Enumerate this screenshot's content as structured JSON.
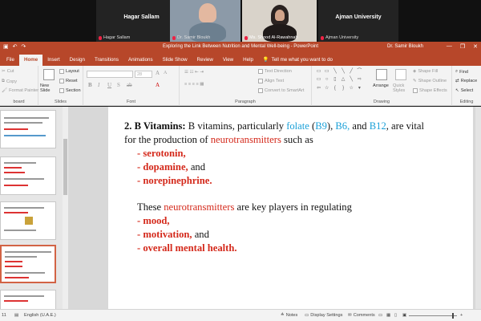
{
  "video": {
    "tiles": [
      {
        "name": "Hagar Sallam",
        "label": "Hagar Sallam"
      },
      {
        "name": "",
        "label": "Dr. Samir Bloukh"
      },
      {
        "name": "",
        "label": "Ms. Shood Al-Rawahnah"
      },
      {
        "name": "Ajman University",
        "label": "Ajman University"
      }
    ]
  },
  "titlebar": {
    "title": "Exploring the Link Between Nutrition and Mental Well-being  -  PowerPoint",
    "user": "Dr. Samir Bloukh",
    "minimize": "—",
    "restore": "❐",
    "close": "✕"
  },
  "tabs": [
    "File",
    "Home",
    "Insert",
    "Design",
    "Transitions",
    "Animations",
    "Slide Show",
    "Review",
    "View",
    "Help"
  ],
  "tell_me": "Tell me what you want to do",
  "ribbon": {
    "clipboard": {
      "cut": "Cut",
      "copy": "Copy",
      "format_painter": "Format Painter",
      "label": "board"
    },
    "slides": {
      "new_slide": "New Slide",
      "layout": "Layout",
      "reset": "Reset",
      "section": "Section",
      "label": "Slides"
    },
    "font": {
      "size": "28",
      "label": "Font"
    },
    "paragraph": {
      "text_direction": "Text Direction",
      "align_text": "Align Text",
      "convert": "Convert to SmartArt",
      "label": "Paragraph"
    },
    "drawing": {
      "arrange": "Arrange",
      "quick_styles": "Quick Styles",
      "shape_fill": "Shape Fill",
      "shape_outline": "Shape Outline",
      "shape_effects": "Shape Effects",
      "label": "Drawing"
    },
    "editing": {
      "find": "Find",
      "replace": "Replace",
      "select": "Select",
      "label": "Editing"
    }
  },
  "slide": {
    "heading_num": "2. B Vitamins:",
    "l1a": " B vitamins, particularly ",
    "folate": "folate",
    "l1b": " (",
    "b9": "B9",
    "l1c": "), ",
    "b6": "B6,",
    "l1d": " and ",
    "b12": "B12",
    "l1e": ", are vital",
    "l2a": "for the production of ",
    "neuro1": "neurotransmitters",
    "l2b": " such as",
    "item1": "- serotonin,",
    "item2": "- dopamine,",
    "item2b": " and",
    "item3": "- norepinephrine.",
    "l3a": "These ",
    "neuro2": "neurotransmitters",
    "l3b": " are key players in regulating",
    "item4": "- mood,",
    "item5": "- motivation,",
    "item5b": " and",
    "item6": "- overall mental health."
  },
  "status": {
    "slide_num": "11",
    "language": "English (U.A.E.)",
    "notes": "Notes",
    "display_settings": "Display Settings",
    "comments": "Comments"
  },
  "colors": {
    "accent": "#b7472a",
    "red_text": "#d4291b",
    "blue_text": "#1aa0d8"
  }
}
